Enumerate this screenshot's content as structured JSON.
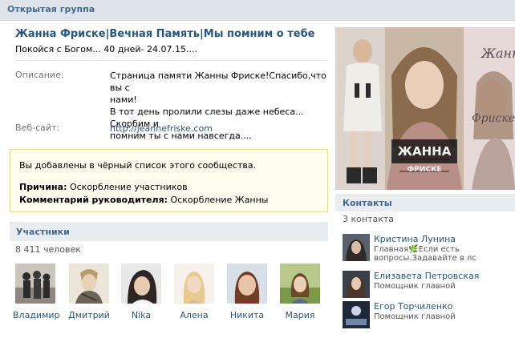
{
  "header": {
    "label": "Открытая группа"
  },
  "group": {
    "title": "Жанна Фриске|Вечная Память|Мы помним о тебе",
    "status": "Покойся с Богом... 40 дней- 24.07.15...."
  },
  "info": {
    "description_label": "Описание:",
    "description_lines": [
      "Страница памяти Жанны Фриске!Спасибо,что вы с",
      "нами!",
      "В тот день пролили слезы даже небеса... Скорбим и",
      "помним ты с нами навсегда...."
    ],
    "website_label": "Веб-сайт:",
    "website_value": "http://jeannefriske.com"
  },
  "blacklist": {
    "message": "Вы добавлены в чёрный список этого сообщества.",
    "reason_label": "Причина:",
    "reason_value": "Оскорбление участников",
    "comment_label": "Комментарий руководителя:",
    "comment_value": "Оскорбление Жанны"
  },
  "members": {
    "heading": "Участники",
    "count": "8 411 человек",
    "list": [
      {
        "name": "Владимир"
      },
      {
        "name": "Дмитрий"
      },
      {
        "name": "Nika"
      },
      {
        "name": "Алена"
      },
      {
        "name": "Никита"
      },
      {
        "name": "Мария"
      }
    ]
  },
  "cover": {
    "caption_main": "ЖАННА",
    "caption_sub": "ФРИСКЕ",
    "script_text_1": "Жанна",
    "script_text_2": "Фриске"
  },
  "contacts": {
    "heading": "Контакты",
    "count": "3 контакта",
    "list": [
      {
        "name": "Кристина Лунина",
        "role": "Главная🌿Если есть вопросы.Задавайте в лс"
      },
      {
        "name": "Елизавета Петровская",
        "role": "Помощник главной"
      },
      {
        "name": "Егор Торчиленко",
        "role": "Помощник главной"
      }
    ]
  },
  "colors": {
    "link": "#2b587a",
    "header_bg": "#dfe4ea",
    "section_bg": "#e9edf1",
    "warning_bg": "#fefcef",
    "warning_border": "#e6d98c"
  }
}
